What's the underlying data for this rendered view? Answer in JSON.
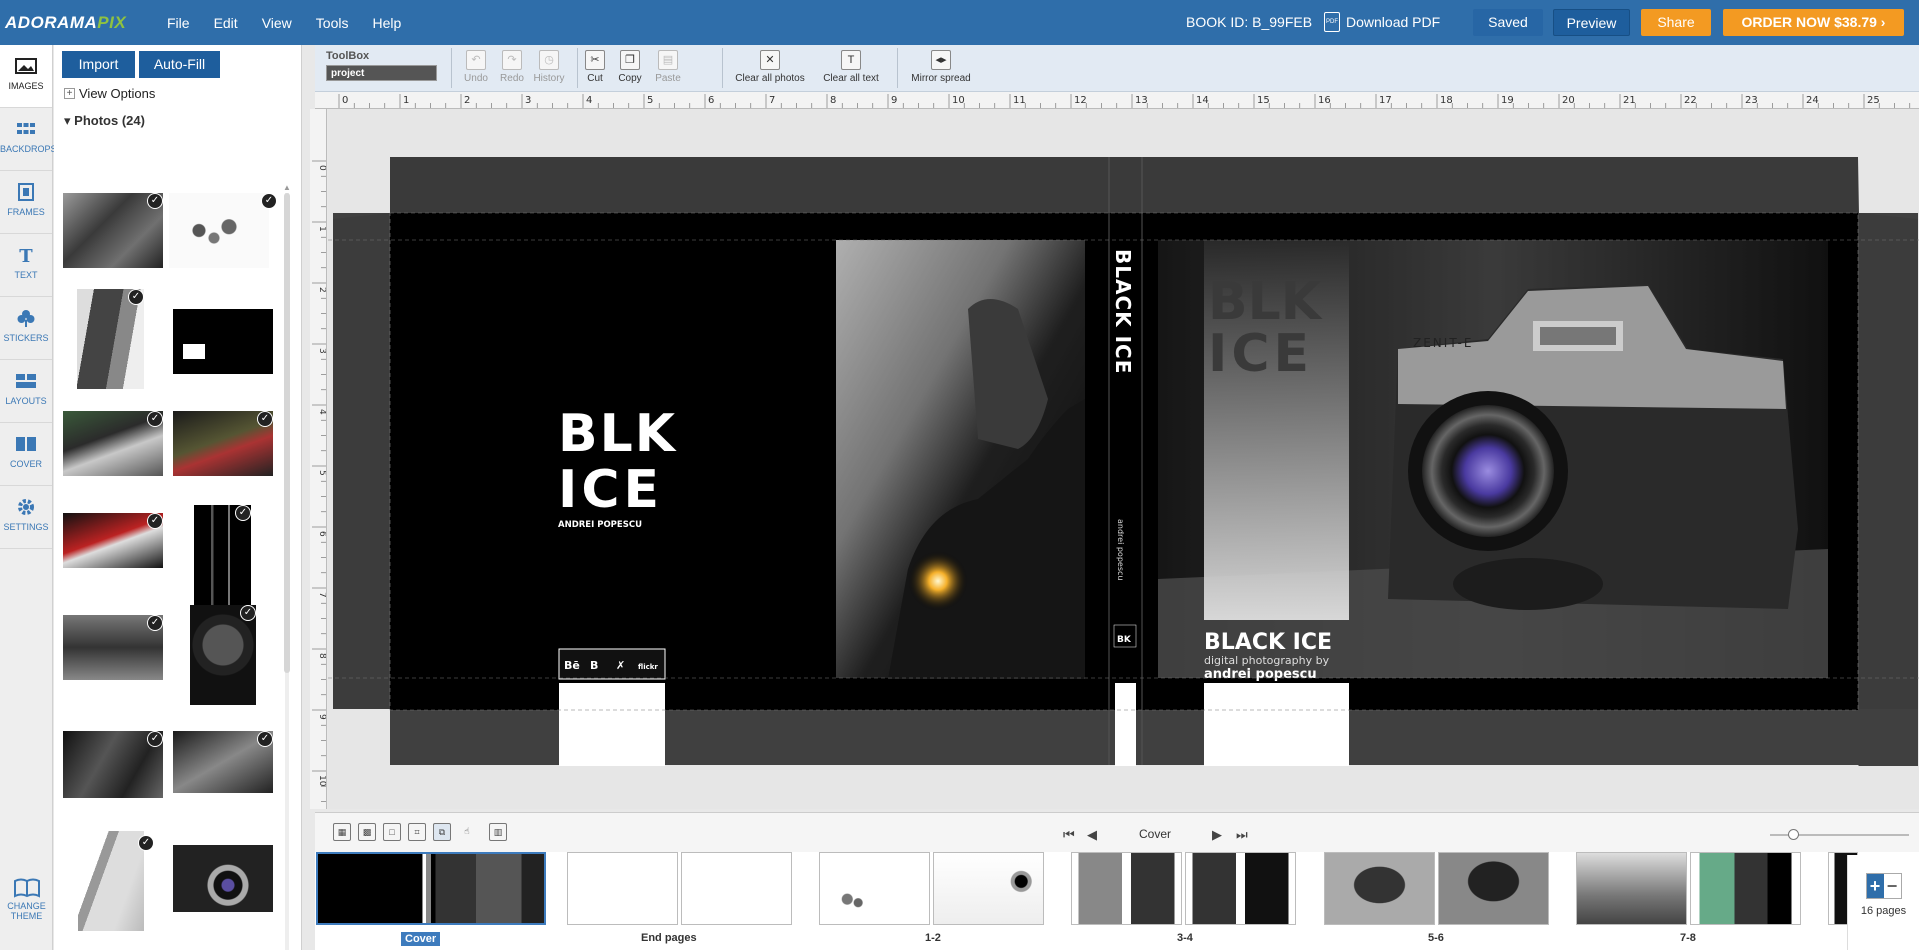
{
  "app": {
    "logo_main": "ADORAMA",
    "logo_accent": "PIX",
    "menu": [
      "File",
      "Edit",
      "View",
      "Tools",
      "Help"
    ],
    "book_id": "BOOK ID: B_99FEB",
    "download_pdf": "Download PDF",
    "saved": "Saved",
    "preview": "Preview",
    "share": "Share",
    "order": "ORDER NOW $38.79"
  },
  "rail": {
    "items": [
      {
        "label": "IMAGES",
        "icon": "images-icon"
      },
      {
        "label": "BACKDROPS",
        "icon": "backdrops-icon"
      },
      {
        "label": "FRAMES",
        "icon": "frames-icon"
      },
      {
        "label": "TEXT",
        "icon": "text-icon"
      },
      {
        "label": "STICKERS",
        "icon": "stickers-icon"
      },
      {
        "label": "LAYOUTS",
        "icon": "layouts-icon"
      },
      {
        "label": "COVER",
        "icon": "cover-icon"
      },
      {
        "label": "SETTINGS",
        "icon": "settings-icon"
      }
    ],
    "change_theme": [
      "CHANGE",
      "THEME"
    ]
  },
  "panel": {
    "import": "Import",
    "autofill": "Auto-Fill",
    "view_options": "View Options",
    "photos_header": "Photos (24)"
  },
  "toolbox": {
    "label": "ToolBox",
    "project": "project",
    "undo": "Undo",
    "redo": "Redo",
    "history": "History",
    "cut": "Cut",
    "copy": "Copy",
    "paste": "Paste",
    "clear_photos": "Clear all photos",
    "clear_text": "Clear all text",
    "mirror": "Mirror spread"
  },
  "ruler": {
    "h_marks": [
      "0",
      "1",
      "2",
      "3",
      "4",
      "5",
      "6",
      "7",
      "8",
      "9",
      "10",
      "11",
      "12",
      "13",
      "14",
      "15",
      "16",
      "17",
      "18",
      "19",
      "20",
      "21",
      "22",
      "23",
      "24",
      "25"
    ],
    "v_marks": [
      "0",
      "1",
      "2",
      "3",
      "4",
      "5",
      "6",
      "7",
      "8",
      "9",
      "10"
    ]
  },
  "cover": {
    "back_logo_line1": "BLK",
    "back_logo_line2": "ICE",
    "back_author": "ANDREI POPESCU",
    "social": [
      "Bē",
      "B",
      "✗",
      "flickr"
    ],
    "spine_title": "BLACK ICE",
    "spine_author": "andrei popescu",
    "front_title": "BLACK ICE",
    "front_subtitle": "digital photography by",
    "front_author": "andrei popescu",
    "camera_brand": "ZENIT-E"
  },
  "nav": {
    "current": "Cover"
  },
  "strip": {
    "labels": [
      "Cover",
      "End pages",
      "1-2",
      "3-4",
      "5-6",
      "7-8"
    ],
    "pages_count": "16 pages"
  },
  "colors": {
    "top_bar": "#2f6eaa",
    "accent_orange": "#f39a22",
    "button_blue": "#1e5e9d",
    "logo_green": "#8fc241"
  }
}
